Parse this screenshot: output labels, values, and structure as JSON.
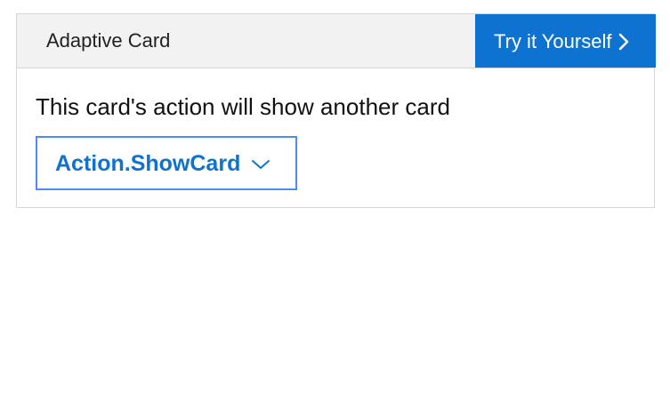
{
  "card": {
    "header_title": "Adaptive Card",
    "try_button_label": "Try it Yourself",
    "body_text": "This card's action will show another card",
    "action_label": "Action.ShowCard"
  },
  "icons": {
    "try_icon": "chevron-right-icon",
    "action_icon": "chevron-down-icon"
  },
  "colors": {
    "accent": "#0e73d0",
    "header_bg": "#f2f2f2",
    "action_border": "#4b8ef0"
  }
}
